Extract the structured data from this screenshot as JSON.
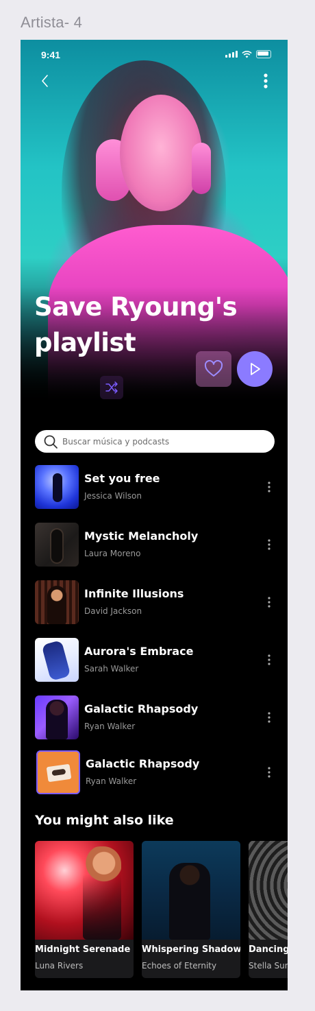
{
  "frame_label": "Artista- 4",
  "status_bar": {
    "time": "9:41"
  },
  "hero": {
    "title": "Save Ryoung's playlist"
  },
  "search": {
    "placeholder": "Buscar música y podcasts"
  },
  "tracks": [
    {
      "title": "Set you free",
      "artist": "Jessica Wilson"
    },
    {
      "title": "Mystic Melancholy",
      "artist": "Laura Moreno"
    },
    {
      "title": "Infinite Illusions",
      "artist": "David Jackson"
    },
    {
      "title": "Aurora's Embrace",
      "artist": "Sarah Walker"
    },
    {
      "title": "Galactic Rhapsody",
      "artist": "Ryan Walker"
    },
    {
      "title": "Galactic Rhapsody",
      "artist": "Ryan Walker"
    }
  ],
  "recommendations": {
    "title": "You might also like",
    "items": [
      {
        "name": "Midnight Serenade",
        "subtitle": "Luna Rivers"
      },
      {
        "name": "Whispering Shadows",
        "subtitle": "Echoes of Eternity"
      },
      {
        "name": "Dancing",
        "subtitle": "Stella Sun"
      }
    ]
  },
  "colors": {
    "accent": "#8b7bff",
    "background": "#000000",
    "frame_bg": "#ecebf0"
  }
}
